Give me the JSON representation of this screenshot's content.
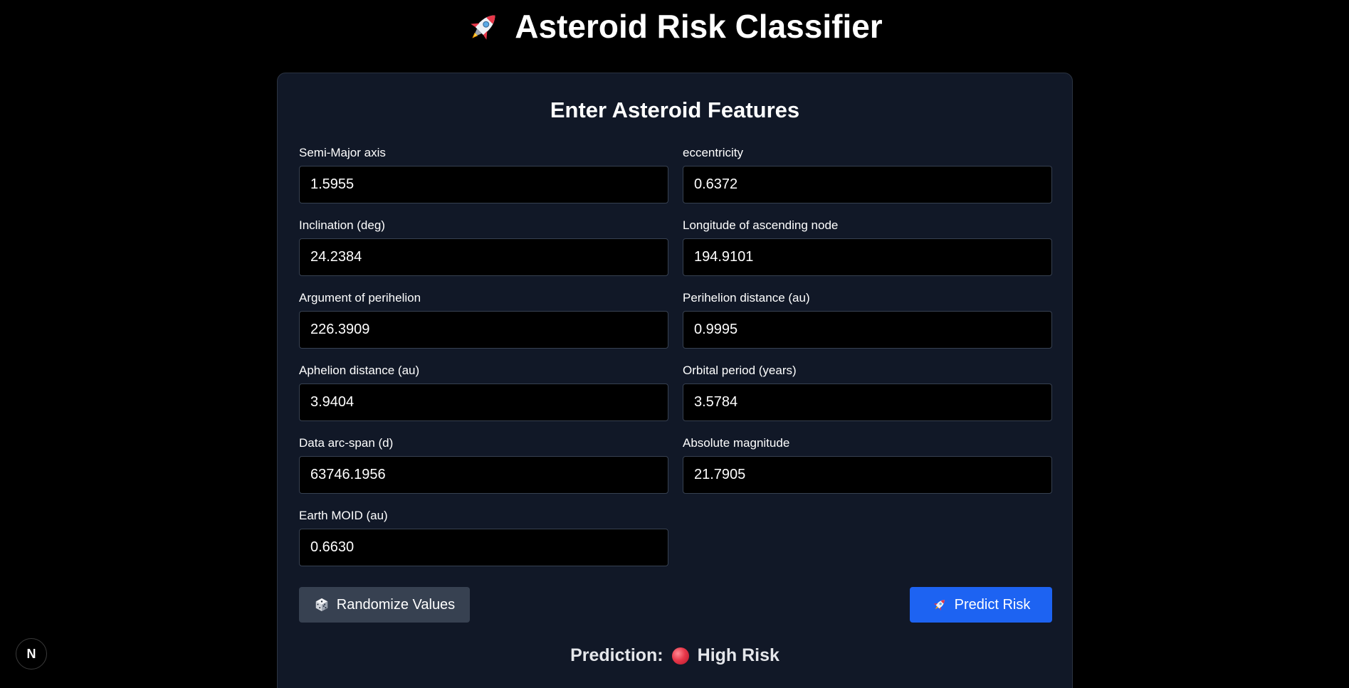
{
  "header": {
    "title": "Asteroid Risk Classifier",
    "title_icon": "rocket-icon"
  },
  "form": {
    "heading": "Enter Asteroid Features",
    "fields": [
      {
        "label": "Semi-Major axis",
        "value": "1.5955"
      },
      {
        "label": "eccentricity",
        "value": "0.6372"
      },
      {
        "label": "Inclination (deg)",
        "value": "24.2384"
      },
      {
        "label": "Longitude of ascending node",
        "value": "194.9101"
      },
      {
        "label": "Argument of perihelion",
        "value": "226.3909"
      },
      {
        "label": "Perihelion distance (au)",
        "value": "0.9995"
      },
      {
        "label": "Aphelion distance (au)",
        "value": "3.9404"
      },
      {
        "label": "Orbital period (years)",
        "value": "3.5784"
      },
      {
        "label": "Data arc-span (d)",
        "value": "63746.1956"
      },
      {
        "label": "Absolute magnitude",
        "value": "21.7905"
      },
      {
        "label": "Earth MOID (au)",
        "value": "0.6630"
      }
    ],
    "randomize_label": "Randomize Values",
    "randomize_icon": "dice-icon",
    "predict_label": "Predict Risk",
    "predict_icon": "rocket-icon"
  },
  "result": {
    "label": "Prediction:",
    "value": "High Risk",
    "indicator_icon": "red-circle-icon"
  },
  "dev_badge": {
    "text": "N"
  },
  "colors": {
    "background": "#000000",
    "card": "#111827",
    "predict_button": "#1d63f2",
    "randomize_button": "#374151",
    "risk_red": "#e8384a"
  }
}
